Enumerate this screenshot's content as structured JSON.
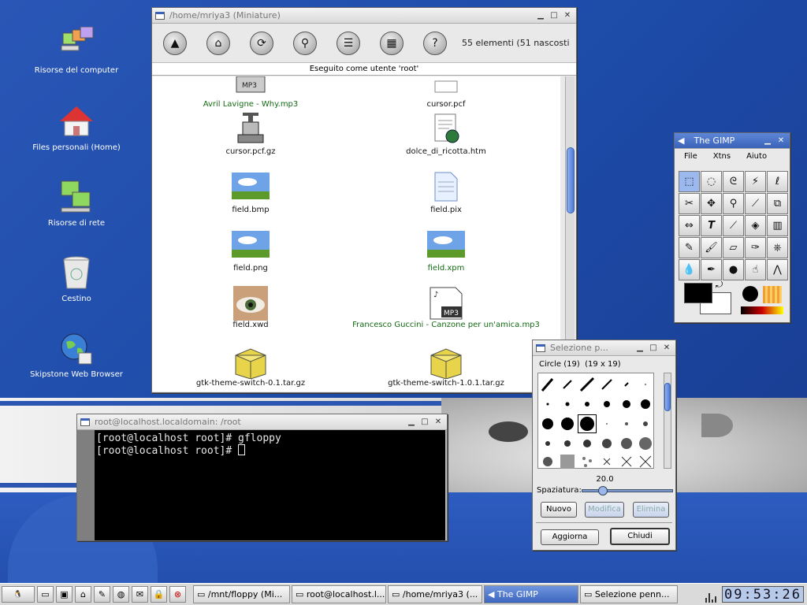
{
  "desktop": {
    "icons": [
      {
        "label": "Risorse del computer",
        "icon": "computer-icon"
      },
      {
        "label": "Files personali (Home)",
        "icon": "home-icon"
      },
      {
        "label": "Risorse di rete",
        "icon": "network-icon"
      },
      {
        "label": "Cestino",
        "icon": "trash-icon"
      },
      {
        "label": "Skipstone Web Browser",
        "icon": "globe-icon"
      }
    ]
  },
  "filer": {
    "title": "/home/mriya3 (Miniature)",
    "count": "55 elementi (51 nascosti",
    "status": "Eseguito come utente 'root'",
    "toolbar": [
      "up-icon",
      "home-icon",
      "refresh-icon",
      "zoom-icon",
      "list-icon",
      "details-icon",
      "help-icon"
    ],
    "files": [
      {
        "name": "Avril Lavigne - Why.mp3",
        "green": true
      },
      {
        "name": "cursor.pcf",
        "green": false
      },
      {
        "name": "cursor.pcf.gz",
        "green": false
      },
      {
        "name": "dolce_di_ricotta.htm",
        "green": false
      },
      {
        "name": "field.bmp",
        "green": false
      },
      {
        "name": "field.pix",
        "green": false
      },
      {
        "name": "field.png",
        "green": false
      },
      {
        "name": "field.xpm",
        "green": true
      },
      {
        "name": "field.xwd",
        "green": false
      },
      {
        "name": "Francesco Guccini - Canzone per un'amica.mp3",
        "green": true
      },
      {
        "name": "gtk-theme-switch-0.1.tar.gz",
        "green": false
      },
      {
        "name": "gtk-theme-switch-1.0.1.tar.gz",
        "green": false
      }
    ]
  },
  "terminal": {
    "title": "root@localhost.localdomain: /root",
    "line1": "[root@localhost root]# gfloppy",
    "line2": "[root@localhost root]# "
  },
  "gimp": {
    "title": "The GIMP",
    "menu": [
      "File",
      "Xtns",
      "Aiuto"
    ]
  },
  "brushes": {
    "title": "Selezione p...",
    "info_name": "Circle (19)",
    "info_size": "(19 x 19)",
    "spacing_value": "20.0",
    "spacing_fraction": 0.2,
    "spacing_label": "Spaziatura:",
    "btn_new": "Nuovo",
    "btn_edit": "Modifica",
    "btn_delete": "Elimina",
    "btn_refresh": "Aggiorna",
    "btn_close": "Chiudi"
  },
  "taskbar": {
    "tasks": [
      {
        "label": "/mnt/floppy (Mi...",
        "active": false
      },
      {
        "label": "root@localhost.l...",
        "active": false
      },
      {
        "label": "/home/mriya3 (...",
        "active": false
      },
      {
        "label": "The GIMP",
        "active": true
      },
      {
        "label": "Selezione penn...",
        "active": false
      }
    ],
    "clock": "09:53:26"
  },
  "colors": {
    "accent": "#3a62b8",
    "green_text": "#136a13"
  }
}
